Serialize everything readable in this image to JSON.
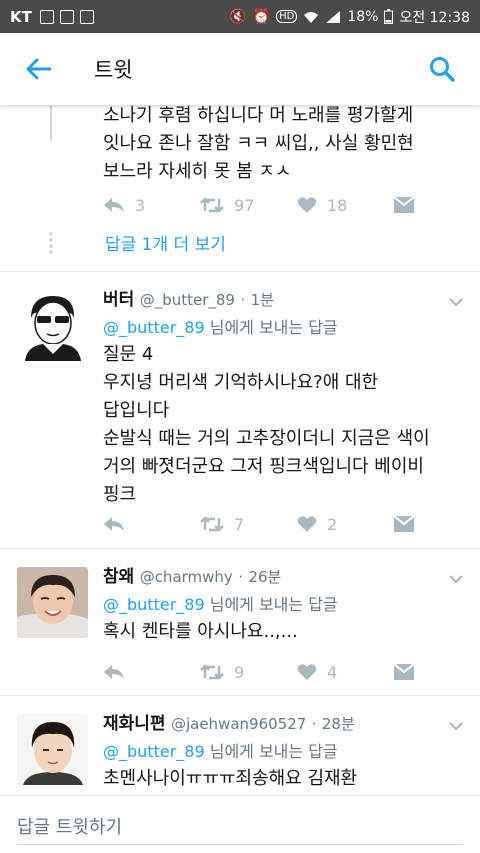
{
  "status_bar": {
    "carrier": "KT",
    "battery": "18%",
    "time": "오전 12:38"
  },
  "header": {
    "title": "트윗"
  },
  "top_tweet": {
    "text_lines": [
      "소나기 후렴 하십니다 머 노래를 평가할게",
      "잇나요 존나 잘함 ㅋㅋ 씨입,, 사실 황민현",
      "보느라 자세히 못 봄 ㅈㅅ"
    ],
    "reply_count": "3",
    "retweet_count": "97",
    "like_count": "18",
    "more_replies": "답글 1개 더 보기"
  },
  "tweets": [
    {
      "name": "버터",
      "handle": "@_butter_89",
      "time": "1분",
      "reply_to_handle": "@_butter_89",
      "reply_to_suffix": "님에게 보내는 답글",
      "lines": [
        "질문 4",
        "우지녕 머리색 기억하시나요?애 대한",
        "답입니다",
        "순발식 때는 거의 고추장이더니 지금은 색이",
        "거의 빠졋더군요 그저 핑크색입니다 베이비",
        "핑크"
      ],
      "reply_count": "",
      "retweet_count": "7",
      "like_count": "2",
      "avatar": "sunglasses-man-avatar"
    },
    {
      "name": "참왜",
      "handle": "@charmwhy",
      "time": "26분",
      "reply_to_handle": "@_butter_89",
      "reply_to_suffix": "님에게 보내는 답글",
      "lines": [
        "혹시 켄타를 아시나요..,..."
      ],
      "reply_count": "",
      "retweet_count": "9",
      "like_count": "4",
      "avatar": "smiling-boy-avatar"
    },
    {
      "name": "재화니편",
      "handle": "@jaehwan960527",
      "time": "28분",
      "reply_to_handle": "@_butter_89",
      "reply_to_suffix": "님에게 보내는 답글",
      "lines": [
        "초멘사나이ㅠㅠㅠ죄송해요 김재환"
      ],
      "avatar": "boy-portrait-avatar"
    }
  ],
  "reply_bar": {
    "placeholder": "답글 트윗하기"
  },
  "colors": {
    "accent": "#1da1f2",
    "muted": "#aab8c2",
    "meta": "#657786"
  }
}
